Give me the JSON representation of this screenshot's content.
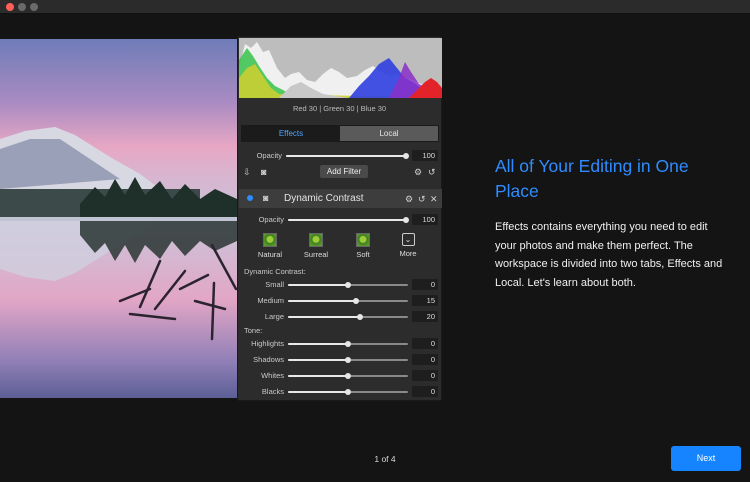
{
  "histogram": {
    "readout": "Red  30  | Green  30  | Blue  30"
  },
  "tabs": {
    "effects": "Effects",
    "local": "Local"
  },
  "global": {
    "opacity_label": "Opacity",
    "opacity_value": "100",
    "opacity_level": 1.0,
    "add_filter": "Add Filter"
  },
  "filter": {
    "title": "Dynamic Contrast",
    "opacity_label": "Opacity",
    "opacity_value": "100",
    "opacity_level": 1.0,
    "presets": [
      "Natural",
      "Surreal",
      "Soft",
      "More"
    ],
    "section": "Dynamic Contrast:",
    "sliders": [
      {
        "label": "Small",
        "value": "0",
        "level": 0.5
      },
      {
        "label": "Medium",
        "value": "15",
        "level": 0.57
      },
      {
        "label": "Large",
        "value": "20",
        "level": 0.6
      }
    ]
  },
  "tone": {
    "section": "Tone:",
    "sliders": [
      {
        "label": "Highlights",
        "value": "0",
        "level": 0.5
      },
      {
        "label": "Shadows",
        "value": "0",
        "level": 0.5
      },
      {
        "label": "Whites",
        "value": "0",
        "level": 0.5
      },
      {
        "label": "Blacks",
        "value": "0",
        "level": 0.5
      }
    ]
  },
  "tutorial": {
    "headline": "All of Your Editing in One Place",
    "body": "Effects contains everything you need to edit your photos and make them perfect. The workspace is divided into two tabs, Effects and Local. Let's learn about both.",
    "page": "1 of 4",
    "next": "Next"
  },
  "colors": {
    "accent": "#1684ff",
    "headline": "#2f8cff",
    "active_tab_text": "#4da3ff"
  }
}
